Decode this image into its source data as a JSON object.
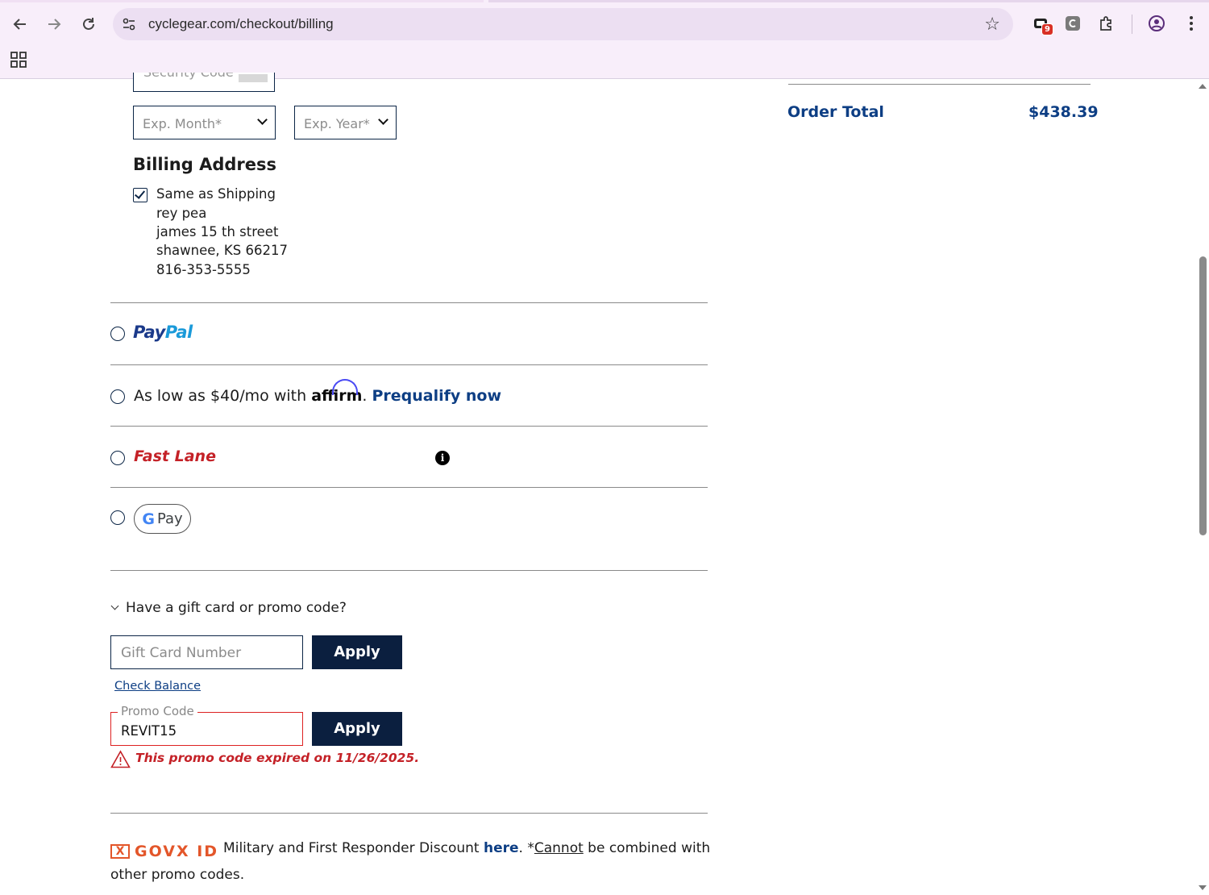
{
  "browser": {
    "url": "cyclegear.com/checkout/billing",
    "extension_badge": "9"
  },
  "card_form": {
    "security_code_placeholder": "Security Code",
    "exp_month_placeholder": "Exp. Month*",
    "exp_year_placeholder": "Exp. Year*"
  },
  "billing": {
    "heading": "Billing Address",
    "same_as_shipping_label": "Same as Shipping",
    "same_as_shipping_checked": true,
    "address_lines": [
      "rey pea",
      "james 15 th street",
      "shawnee, KS 66217",
      "816-353-5555"
    ]
  },
  "payment_options": {
    "paypal": {
      "pay": "Pay",
      "pal": "Pal"
    },
    "affirm": {
      "prefix": "As low as $40/mo with ",
      "logo": "affirm",
      "suffix": ". ",
      "link": "Prequalify now"
    },
    "fastlane": "Fast Lane",
    "gpay": {
      "g": "G",
      "pay": "Pay"
    }
  },
  "promo": {
    "toggle_label": "Have a gift card or promo code?",
    "gift_card_placeholder": "Gift Card Number",
    "apply_label": "Apply",
    "check_balance": "Check Balance",
    "promo_code_label": "Promo Code",
    "promo_code_value": "REVIT15",
    "error": "This promo code expired on 11/26/2025."
  },
  "govx": {
    "logo": "GOVX ID",
    "text": "Military and First Responder Discount ",
    "here": "here",
    "mid": ". *",
    "cannot": "Cannot",
    "tail": " be combined with other promo codes."
  },
  "summary": {
    "order_total_label": "Order Total",
    "order_total_value": "$438.39"
  },
  "colors": {
    "brand_navy": "#0b1f3f",
    "link_blue": "#0d3e84",
    "error_red": "#c42127"
  }
}
